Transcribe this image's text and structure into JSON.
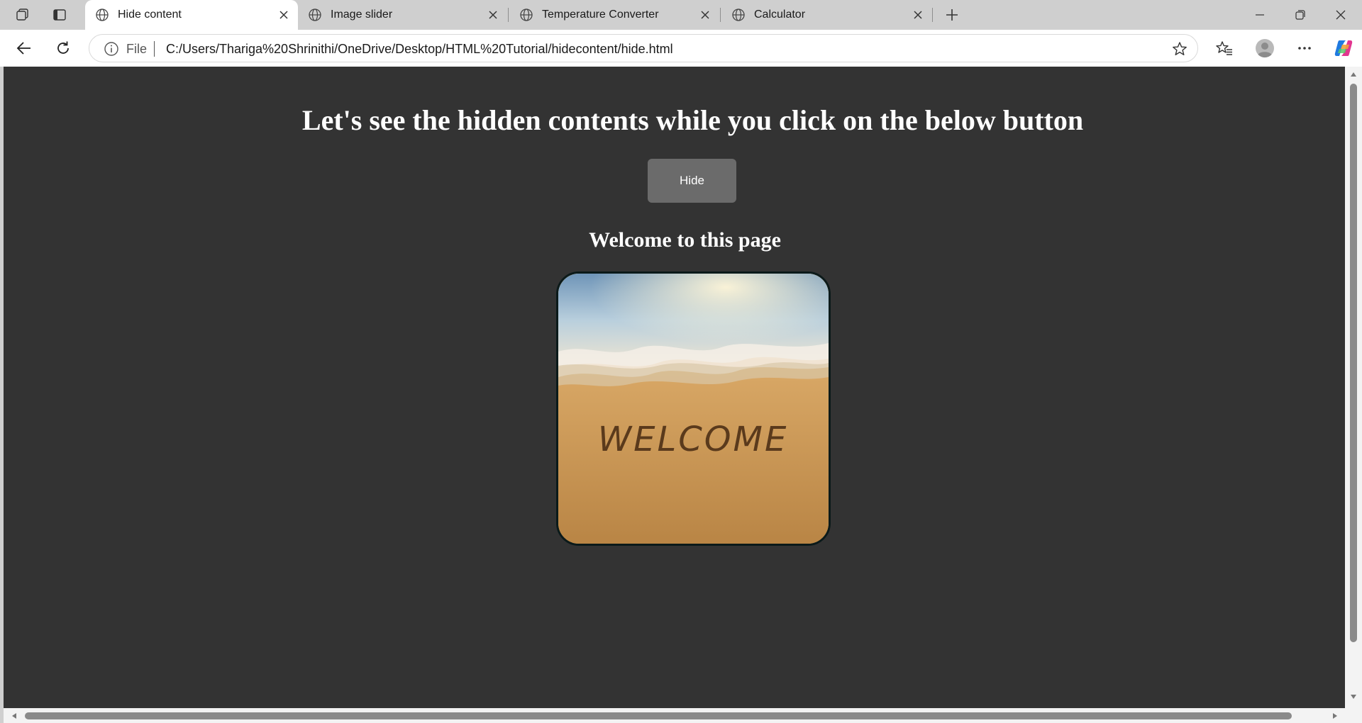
{
  "browser": {
    "tabs": [
      {
        "title": "Hide content",
        "active": true
      },
      {
        "title": "Image slider",
        "active": false
      },
      {
        "title": "Temperature Converter",
        "active": false
      },
      {
        "title": "Calculator",
        "active": false
      }
    ],
    "address": {
      "scheme_label": "File",
      "url": "C:/Users/Thariga%20Shrinithi/OneDrive/Desktop/HTML%20Tutorial/hidecontent/hide.html"
    }
  },
  "page": {
    "background_color": "#333333",
    "heading": "Let's see the hidden contents while you click on the below button",
    "hide_button_label": "Hide",
    "subheading": "Welcome to this page",
    "image_caption_text": "WELCOME"
  },
  "icons": {
    "workspaces": "workspaces-icon",
    "tab_actions": "tab-actions-icon",
    "tab_favicon": "globe-icon",
    "close": "close-icon",
    "new_tab": "plus-icon",
    "minimize": "minimize-icon",
    "restore": "restore-icon",
    "back": "back-arrow-icon",
    "refresh": "refresh-icon",
    "info": "info-icon",
    "favorite": "star-icon",
    "favorites": "favorites-icon",
    "profile": "profile-icon",
    "more": "more-icon",
    "copilot": "copilot-icon"
  }
}
